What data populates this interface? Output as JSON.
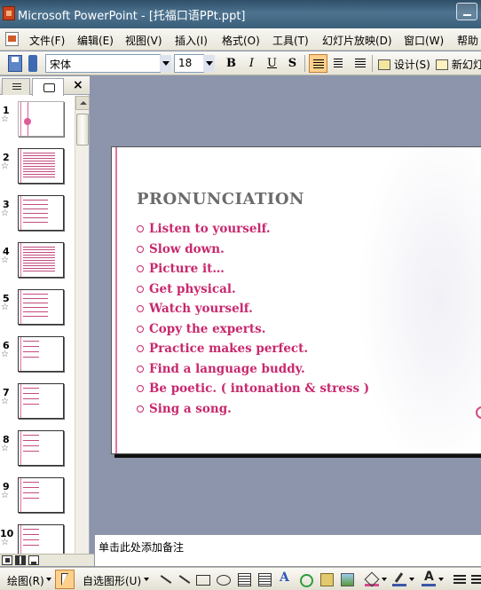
{
  "window": {
    "title": "Microsoft PowerPoint - [托福口语PPt.ppt]"
  },
  "menu": [
    "文件(F)",
    "编辑(E)",
    "视图(V)",
    "插入(I)",
    "格式(O)",
    "工具(T)",
    "幻灯片放映(D)",
    "窗口(W)",
    "帮助"
  ],
  "toolbar": {
    "font_name": "宋体",
    "font_size": "18",
    "bold_label": "B",
    "italic_label": "I",
    "underline_label": "U",
    "shadow_label": "S",
    "design_label": "设计(S)",
    "new_slide_label": "新幻灯"
  },
  "panel": {
    "close_label": "×",
    "star": "☆",
    "slide_numbers": [
      "1",
      "2",
      "3",
      "4",
      "5",
      "6",
      "7",
      "8",
      "9",
      "10"
    ],
    "selected_slide": 1
  },
  "slide": {
    "title": "PRONUNCIATION",
    "bullets": [
      "Listen to yourself.",
      "Slow down.",
      "Picture it…",
      "Get physical.",
      "Watch yourself.",
      "Copy the experts.",
      "Practice makes perfect.",
      "Find a language buddy.",
      "Be poetic. ( intonation & stress )",
      "Sing a song."
    ],
    "colors": {
      "title": "#6b6b6b",
      "bullet_text": "#c8286e",
      "accent": "#e5739f"
    }
  },
  "notes": {
    "placeholder": "单击此处添加备注"
  },
  "drawing_toolbar": {
    "draw_label": "绘图(R)",
    "autoshapes_label": "自选图形(U)"
  }
}
